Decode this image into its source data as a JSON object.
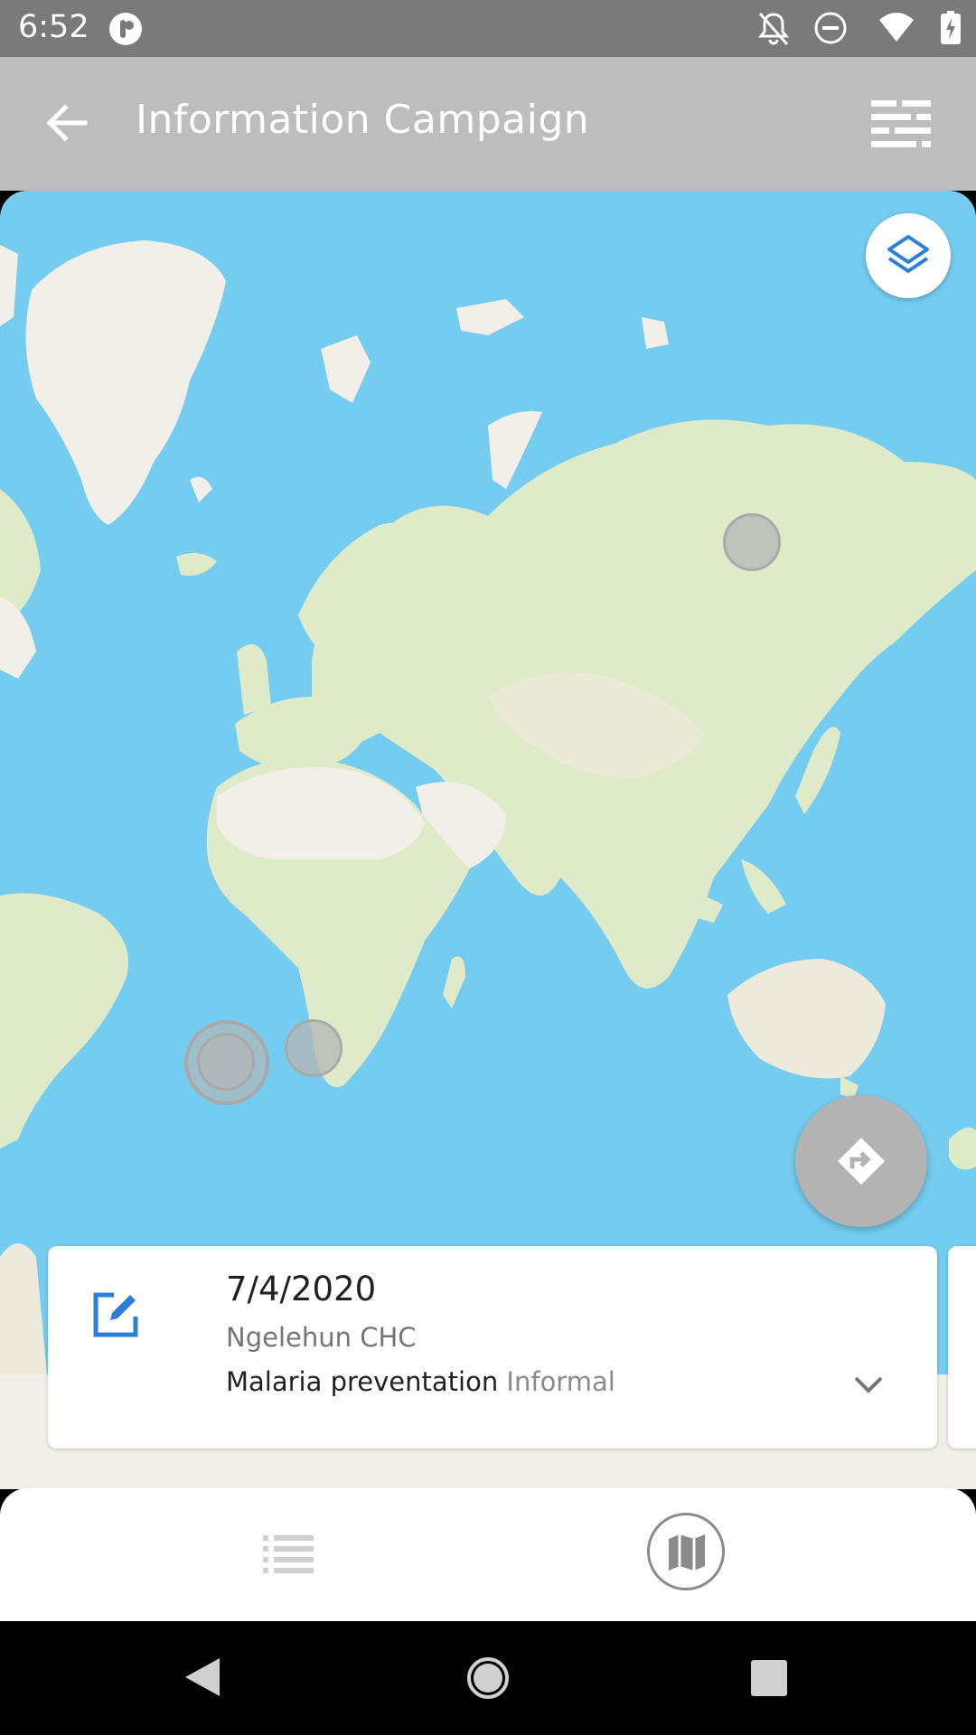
{
  "status_bar": {
    "time": "6:52",
    "icons": [
      "app-notification-icon",
      "notifications-off-icon",
      "do-not-disturb-icon",
      "wifi-icon",
      "battery-charging-icon"
    ]
  },
  "app_bar": {
    "title": "Information Campaign",
    "back_icon": "arrow-back-icon",
    "filter_icon": "filter-list-icon"
  },
  "map": {
    "layers_icon": "layers-icon",
    "navigate_icon": "directions-icon",
    "colors": {
      "water": "#74cdf0",
      "land": "#dfebc8",
      "desert": "#f2efe9",
      "cluster": "#b5b5b5"
    }
  },
  "event_card": {
    "icon": "edit-icon",
    "date": "7/4/2020",
    "org_unit": "Ngelehun CHC",
    "value_primary": "Malaria preventation",
    "value_secondary": "Informal",
    "expand_icon": "chevron-down-icon"
  },
  "bottom_nav": {
    "items": [
      {
        "name": "list",
        "icon": "list-view-icon",
        "selected": false
      },
      {
        "name": "map",
        "icon": "map-view-icon",
        "selected": true
      }
    ]
  },
  "system_nav": {
    "items": [
      "back",
      "home",
      "recents"
    ]
  }
}
